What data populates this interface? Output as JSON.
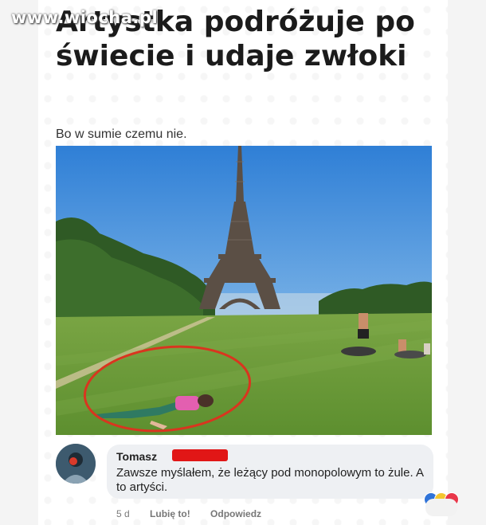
{
  "watermark": "www.wiocha.pl",
  "post": {
    "title": "Artystka podróżuje po świecie i udaje zwłoki",
    "subtitle": "Bo w sumie czemu nie."
  },
  "comment": {
    "author": "Tomasz",
    "text": "Zawsze myślałem, że leżący pod monopolowym to żule. A to artyści.",
    "time": "5 d",
    "like": "Lubię to!",
    "reply": "Odpowiedz"
  },
  "colors": {
    "annotation_circle": "#d9351f",
    "redaction": "#e11616"
  },
  "icons": {
    "reaction_1": "like-icon",
    "reaction_2": "haha-icon",
    "reaction_3": "love-icon"
  }
}
